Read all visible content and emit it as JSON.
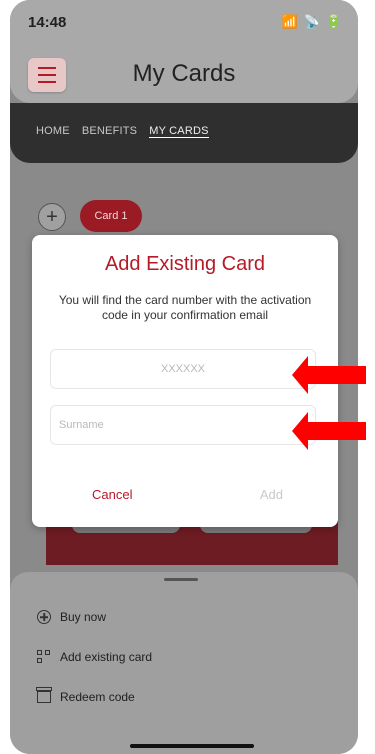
{
  "status": {
    "time": "14:48",
    "signal": "📶",
    "wifi": "📡",
    "battery": "🔋"
  },
  "header": {
    "title": "My Cards"
  },
  "nav": {
    "items": [
      "HOME",
      "BENEFITS",
      "MY CARDS"
    ]
  },
  "cards": {
    "pill_label": "Card 1",
    "add_label": "+"
  },
  "modal": {
    "title": "Add Existing Card",
    "message": "You will find the card number with the activation code in your confirmation email",
    "code_placeholder": "XXXXXX",
    "surname_placeholder": "Surname",
    "cancel_label": "Cancel",
    "add_label": "Add"
  },
  "sheet": {
    "items": [
      {
        "label": "Buy now",
        "icon": "circle-plus-icon"
      },
      {
        "label": "Add existing card",
        "icon": "qr-add-icon"
      },
      {
        "label": "Redeem code",
        "icon": "gift-icon"
      }
    ]
  },
  "colors": {
    "accent": "#b51a28",
    "overlay": "#8a8a8a",
    "modal_bg": "#ffffff"
  }
}
